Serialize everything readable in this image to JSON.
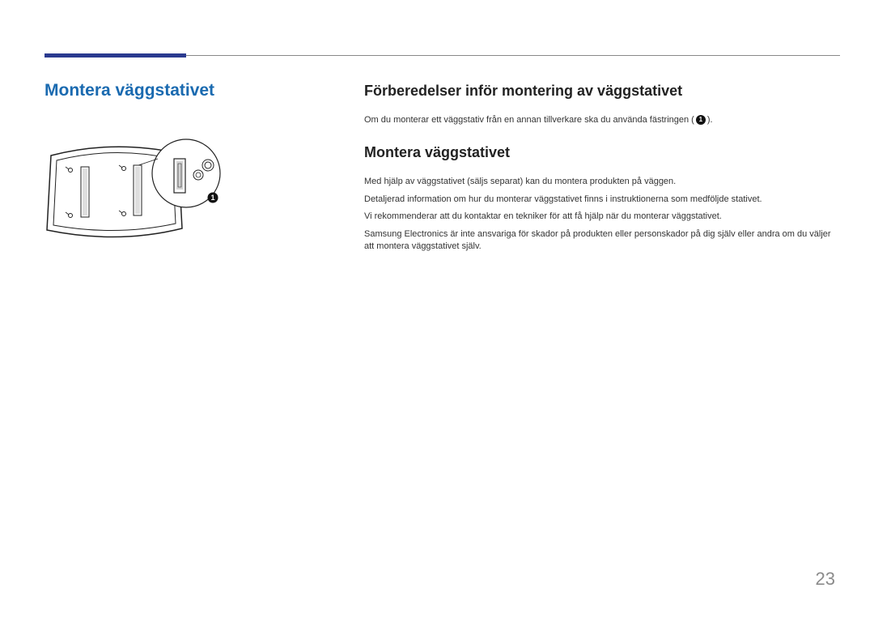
{
  "left": {
    "heading": "Montera väggstativet"
  },
  "right": {
    "section1": {
      "heading": "Förberedelser inför montering av väggstativet",
      "p1_a": "Om du monterar ett väggstativ från en annan tillverkare ska du använda fästringen (",
      "p1_b": ")."
    },
    "section2": {
      "heading": "Montera väggstativet",
      "p1": "Med hjälp av väggstativet (säljs separat) kan du montera produkten på väggen.",
      "p2": "Detaljerad information om hur du monterar väggstativet finns i instruktionerna som medföljde stativet.",
      "p3": "Vi rekommenderar att du kontaktar en tekniker för att få hjälp när du monterar väggstativet.",
      "p4": "Samsung Electronics är inte ansvariga för skador på produkten eller personskador på dig själv eller andra om du väljer att montera väggstativet själv."
    }
  },
  "badge_label": "1",
  "page_number": "23"
}
